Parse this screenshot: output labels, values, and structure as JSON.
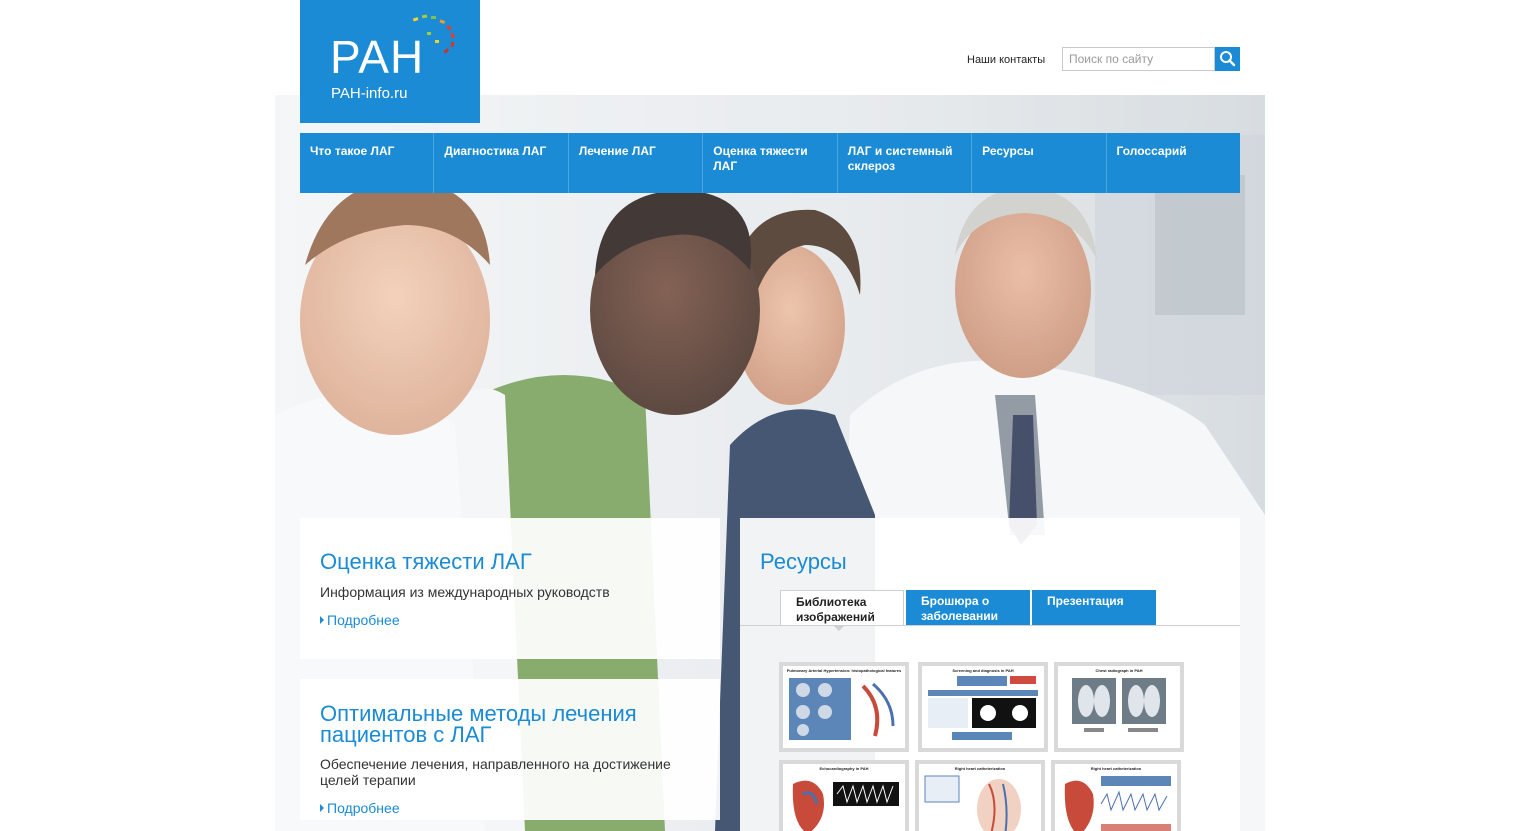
{
  "logo": {
    "brand": "PAH",
    "domain": "PAH-info.ru"
  },
  "header": {
    "contacts_label": "Наши контакты",
    "search_placeholder": "Поиск по сайту"
  },
  "nav": {
    "items": [
      {
        "label": "Что такое ЛАГ"
      },
      {
        "label": "Диагностика ЛАГ"
      },
      {
        "label": "Лечение ЛАГ"
      },
      {
        "label": "Оценка тяжести ЛАГ"
      },
      {
        "label": "ЛАГ и системный склероз"
      },
      {
        "label": "Ресурсы"
      },
      {
        "label": "Голоссарий"
      }
    ]
  },
  "cards": {
    "severity": {
      "title": "Оценка тяжести ЛАГ",
      "text": "Информация из международных руководств",
      "more": "Подробнее"
    },
    "treatment": {
      "title": "Оптимальные методы лечения пациентов с ЛАГ",
      "text": "Обеспечение лечения, направленного на достижение целей терапии",
      "more": "Подробнее"
    },
    "resources": {
      "title": "Ресурсы",
      "tabs": [
        {
          "label": "Библиотека изображений",
          "active": true
        },
        {
          "label": "Брошюра о заболевании",
          "active": false
        },
        {
          "label": "Презентация",
          "active": false
        }
      ],
      "thumbnails": [
        {
          "caption": "Pulmonary Arterial Hypertension: histopathological features"
        },
        {
          "caption": "Screening and diagnosis in PAH"
        },
        {
          "caption": "Chest radiograph in PAH"
        },
        {
          "caption": "Echocardiography in PAH"
        },
        {
          "caption": "Right heart catheterization"
        },
        {
          "caption": "Right heart catheterization"
        }
      ]
    }
  },
  "colors": {
    "brand_blue": "#1a8bd4",
    "nav_divider": "#4ba6e0"
  },
  "icons": {
    "search": "search-icon",
    "logo_dots": "logo-dots-icon",
    "more_arrow": "triangle-right-icon"
  }
}
